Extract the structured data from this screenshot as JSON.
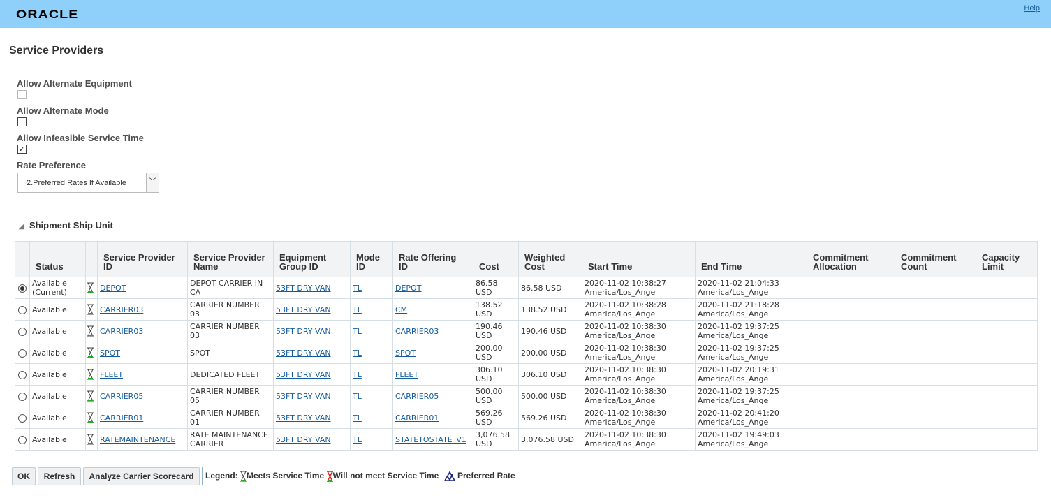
{
  "header": {
    "brand": "ORACLE",
    "help": "Help"
  },
  "page_title": "Service Providers",
  "form": {
    "allow_alternate_equipment": {
      "label": "Allow Alternate Equipment",
      "checked": false
    },
    "allow_alternate_mode": {
      "label": "Allow Alternate Mode",
      "checked": false
    },
    "allow_infeasible_service_time": {
      "label": "Allow Infeasible Service Time",
      "checked": true
    },
    "rate_preference": {
      "label": "Rate Preference",
      "value": "2.Preferred Rates If Available"
    }
  },
  "section": {
    "title": "Shipment Ship Unit"
  },
  "columns": [
    "",
    "Status",
    "",
    "Service Provider ID",
    "Service Provider Name",
    "Equipment Group ID",
    "Mode ID",
    "Rate Offering ID",
    "Cost",
    "Weighted Cost",
    "Start Time",
    "End Time",
    "Commitment Allocation",
    "Commitment Count",
    "Capacity Limit"
  ],
  "rows": [
    {
      "selected": true,
      "status": "Available (Current)",
      "sp_id": "DEPOT",
      "sp_name": "DEPOT CARRIER IN CA",
      "equip": "53FT DRY VAN",
      "mode": "TL",
      "rate": "DEPOT",
      "cost": "86.58 USD",
      "wcost": "86.58 USD",
      "start": "2020-11-02 10:38:27 America/Los_Ange",
      "end": "2020-11-02 21:04:33 America/Los_Ange"
    },
    {
      "selected": false,
      "status": "Available",
      "sp_id": "CARRIER03",
      "sp_name": "CARRIER NUMBER 03",
      "equip": "53FT DRY VAN",
      "mode": "TL",
      "rate": "CM",
      "cost": "138.52 USD",
      "wcost": "138.52 USD",
      "start": "2020-11-02 10:38:28 America/Los_Ange",
      "end": "2020-11-02 21:18:28 America/Los_Ange"
    },
    {
      "selected": false,
      "status": "Available",
      "sp_id": "CARRIER03",
      "sp_name": "CARRIER NUMBER 03",
      "equip": "53FT DRY VAN",
      "mode": "TL",
      "rate": "CARRIER03",
      "cost": "190.46 USD",
      "wcost": "190.46 USD",
      "start": "2020-11-02 10:38:30 America/Los_Ange",
      "end": "2020-11-02 19:37:25 America/Los_Ange"
    },
    {
      "selected": false,
      "status": "Available",
      "sp_id": "SPOT",
      "sp_name": "SPOT",
      "equip": "53FT DRY VAN",
      "mode": "TL",
      "rate": "SPOT",
      "cost": "200.00 USD",
      "wcost": "200.00 USD",
      "start": "2020-11-02 10:38:30 America/Los_Ange",
      "end": "2020-11-02 19:37:25 America/Los_Ange"
    },
    {
      "selected": false,
      "status": "Available",
      "sp_id": "FLEET",
      "sp_name": "DEDICATED FLEET",
      "equip": "53FT DRY VAN",
      "mode": "TL",
      "rate": "FLEET",
      "cost": "306.10 USD",
      "wcost": "306.10 USD",
      "start": "2020-11-02 10:38:30 America/Los_Ange",
      "end": "2020-11-02 20:19:31 America/Los_Ange"
    },
    {
      "selected": false,
      "status": "Available",
      "sp_id": "CARRIER05",
      "sp_name": "CARRIER NUMBER 05",
      "equip": "53FT DRY VAN",
      "mode": "TL",
      "rate": "CARRIER05",
      "cost": "500.00 USD",
      "wcost": "500.00 USD",
      "start": "2020-11-02 10:38:30 America/Los_Ange",
      "end": "2020-11-02 19:37:25 America/Los_Ange"
    },
    {
      "selected": false,
      "status": "Available",
      "sp_id": "CARRIER01",
      "sp_name": "CARRIER NUMBER 01",
      "equip": "53FT DRY VAN",
      "mode": "TL",
      "rate": "CARRIER01",
      "cost": "569.26 USD",
      "wcost": "569.26 USD",
      "start": "2020-11-02 10:38:30 America/Los_Ange",
      "end": "2020-11-02 20:41:20 America/Los_Ange"
    },
    {
      "selected": false,
      "status": "Available",
      "sp_id": "RATEMAINTENANCE",
      "sp_name": "RATE MAINTENANCE CARRIER",
      "equip": "53FT DRY VAN",
      "mode": "TL",
      "rate": "STATETOSTATE_V1",
      "cost": "3,076.58 USD",
      "wcost": "3,076.58 USD",
      "start": "2020-11-02 10:38:30 America/Los_Ange",
      "end": "2020-11-02 19:49:03 America/Los_Ange"
    }
  ],
  "buttons": {
    "ok": "OK",
    "refresh": "Refresh",
    "analyze": "Analyze Carrier Scorecard"
  },
  "legend": {
    "label": "Legend:",
    "meets": "Meets Service Time",
    "not_meet": "Will not meet Service Time",
    "preferred": "Preferred Rate"
  }
}
